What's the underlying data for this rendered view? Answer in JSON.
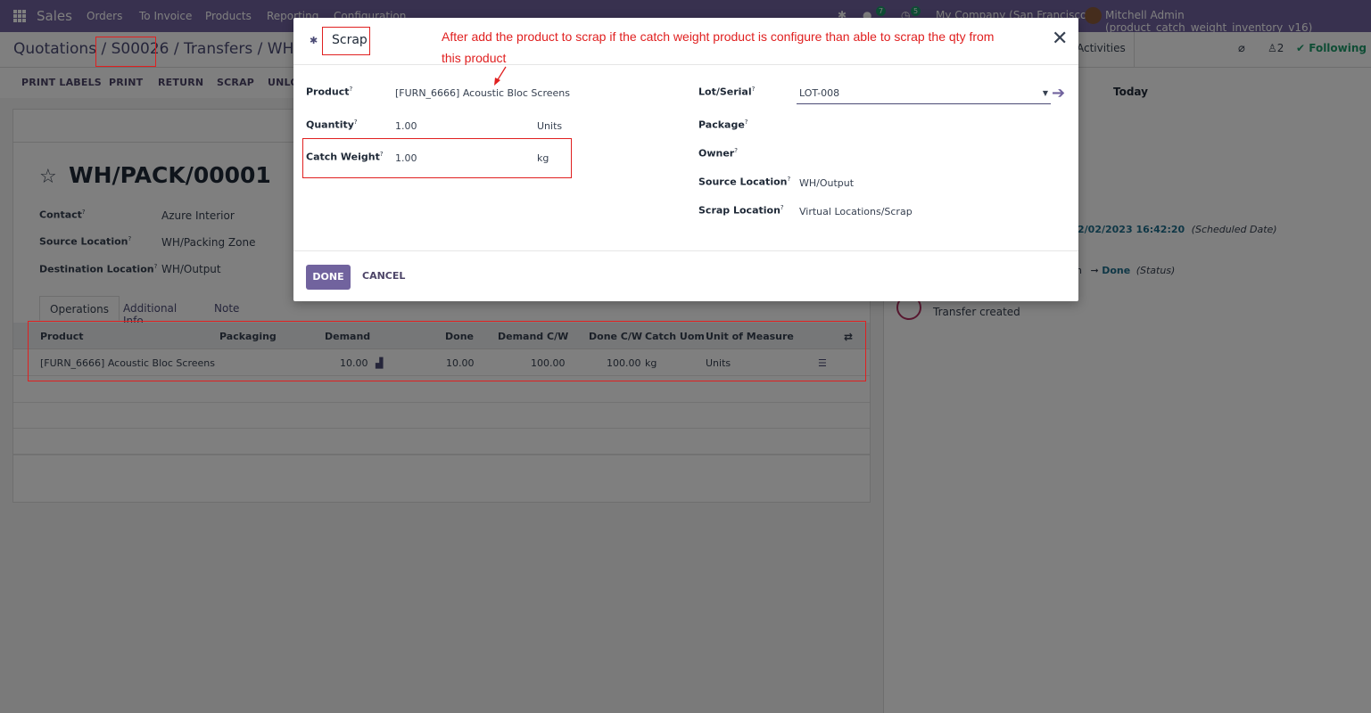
{
  "navbar": {
    "app_name": "Sales",
    "menu": [
      "Orders",
      "To Invoice",
      "Products",
      "Reporting",
      "Configuration"
    ],
    "chat_count": "7",
    "activity_count": "5",
    "company": "My Company (San Francisco)",
    "user": "Mitchell Admin (product_catch_weight_inventory_v16)"
  },
  "breadcrumb": {
    "root": "Quotations /",
    "order": "S00026",
    "transfers": "/ Transfers / WH/PAC"
  },
  "chatter_top": {
    "activities": "Activities",
    "followers": "2",
    "following": "Following",
    "today": "Today"
  },
  "actions": [
    "PRINT LABELS",
    "PRINT",
    "RETURN",
    "SCRAP",
    "UNLO"
  ],
  "record": {
    "title": "WH/PACK/00001",
    "contact_label": "Contact",
    "contact": "Azure Interior",
    "source_label": "Source Location",
    "source": "WH/Packing Zone",
    "dest_label": "Destination Location",
    "dest": "WH/Output"
  },
  "tabs": [
    "Operations",
    "Additional Info",
    "Note"
  ],
  "ops_table": {
    "headers": [
      "Product",
      "Packaging",
      "Demand",
      "Done",
      "Demand C/W",
      "Done C/W",
      "Catch Uom",
      "Unit of Measure"
    ],
    "row": {
      "product": "[FURN_6666] Acoustic Bloc Screens",
      "demand": "10.00",
      "done": "10.00",
      "demand_cw": "100.00",
      "done_cw": "100.00",
      "catch_uom": "kg",
      "uom": "Units"
    }
  },
  "chatter_log": {
    "date": "2/02/2023 16:42:20",
    "date_note": "(Scheduled Date)",
    "status_arrow": "➞",
    "status_value": "Done",
    "status_note": "(Status)",
    "status_prefix": "n",
    "created": "Transfer created"
  },
  "modal": {
    "title": "Scrap",
    "annotation": "After add the product to scrap if the catch weight product is configure than able to scrap the qty from this product",
    "product_label": "Product",
    "product": "[FURN_6666] Acoustic Bloc Screens",
    "quantity_label": "Quantity",
    "quantity": "1.00",
    "quantity_uom": "Units",
    "catch_weight_label": "Catch Weight",
    "catch_weight": "1.00",
    "catch_weight_uom": "kg",
    "lot_label": "Lot/Serial",
    "lot": "LOT-008",
    "package_label": "Package",
    "owner_label": "Owner",
    "source_label": "Source Location",
    "source": "WH/Output",
    "scrap_loc_label": "Scrap Location",
    "scrap_loc": "Virtual Locations/Scrap",
    "done": "DONE",
    "cancel": "CANCEL",
    "help_mark": "?"
  }
}
